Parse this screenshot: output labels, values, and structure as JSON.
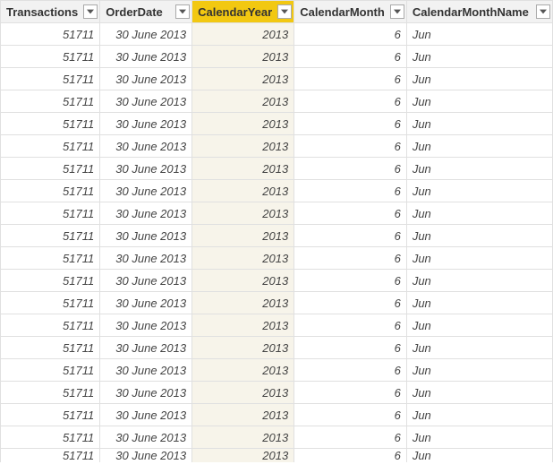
{
  "columns": [
    {
      "key": "transactions",
      "label": "Transactions",
      "class": "col-transactions num",
      "selected": false
    },
    {
      "key": "orderDate",
      "label": "OrderDate",
      "class": "col-orderdate date",
      "selected": false
    },
    {
      "key": "calendarYear",
      "label": "CalendarYear",
      "class": "col-year year",
      "selected": true
    },
    {
      "key": "calendarMonth",
      "label": "CalendarMonth",
      "class": "col-month num",
      "selected": false
    },
    {
      "key": "calendarMonthName",
      "label": "CalendarMonthName",
      "class": "col-monthname text",
      "selected": false
    }
  ],
  "rows": [
    {
      "transactions": "51711",
      "orderDate": "30 June 2013",
      "calendarYear": "2013",
      "calendarMonth": "6",
      "calendarMonthName": "Jun"
    },
    {
      "transactions": "51711",
      "orderDate": "30 June 2013",
      "calendarYear": "2013",
      "calendarMonth": "6",
      "calendarMonthName": "Jun"
    },
    {
      "transactions": "51711",
      "orderDate": "30 June 2013",
      "calendarYear": "2013",
      "calendarMonth": "6",
      "calendarMonthName": "Jun"
    },
    {
      "transactions": "51711",
      "orderDate": "30 June 2013",
      "calendarYear": "2013",
      "calendarMonth": "6",
      "calendarMonthName": "Jun"
    },
    {
      "transactions": "51711",
      "orderDate": "30 June 2013",
      "calendarYear": "2013",
      "calendarMonth": "6",
      "calendarMonthName": "Jun"
    },
    {
      "transactions": "51711",
      "orderDate": "30 June 2013",
      "calendarYear": "2013",
      "calendarMonth": "6",
      "calendarMonthName": "Jun"
    },
    {
      "transactions": "51711",
      "orderDate": "30 June 2013",
      "calendarYear": "2013",
      "calendarMonth": "6",
      "calendarMonthName": "Jun"
    },
    {
      "transactions": "51711",
      "orderDate": "30 June 2013",
      "calendarYear": "2013",
      "calendarMonth": "6",
      "calendarMonthName": "Jun"
    },
    {
      "transactions": "51711",
      "orderDate": "30 June 2013",
      "calendarYear": "2013",
      "calendarMonth": "6",
      "calendarMonthName": "Jun"
    },
    {
      "transactions": "51711",
      "orderDate": "30 June 2013",
      "calendarYear": "2013",
      "calendarMonth": "6",
      "calendarMonthName": "Jun"
    },
    {
      "transactions": "51711",
      "orderDate": "30 June 2013",
      "calendarYear": "2013",
      "calendarMonth": "6",
      "calendarMonthName": "Jun"
    },
    {
      "transactions": "51711",
      "orderDate": "30 June 2013",
      "calendarYear": "2013",
      "calendarMonth": "6",
      "calendarMonthName": "Jun"
    },
    {
      "transactions": "51711",
      "orderDate": "30 June 2013",
      "calendarYear": "2013",
      "calendarMonth": "6",
      "calendarMonthName": "Jun"
    },
    {
      "transactions": "51711",
      "orderDate": "30 June 2013",
      "calendarYear": "2013",
      "calendarMonth": "6",
      "calendarMonthName": "Jun"
    },
    {
      "transactions": "51711",
      "orderDate": "30 June 2013",
      "calendarYear": "2013",
      "calendarMonth": "6",
      "calendarMonthName": "Jun"
    },
    {
      "transactions": "51711",
      "orderDate": "30 June 2013",
      "calendarYear": "2013",
      "calendarMonth": "6",
      "calendarMonthName": "Jun"
    },
    {
      "transactions": "51711",
      "orderDate": "30 June 2013",
      "calendarYear": "2013",
      "calendarMonth": "6",
      "calendarMonthName": "Jun"
    },
    {
      "transactions": "51711",
      "orderDate": "30 June 2013",
      "calendarYear": "2013",
      "calendarMonth": "6",
      "calendarMonthName": "Jun"
    },
    {
      "transactions": "51711",
      "orderDate": "30 June 2013",
      "calendarYear": "2013",
      "calendarMonth": "6",
      "calendarMonthName": "Jun"
    }
  ],
  "partialRow": {
    "transactions": "51711",
    "orderDate": "30 June 2013",
    "calendarYear": "2013",
    "calendarMonth": "6",
    "calendarMonthName": "Jun"
  }
}
